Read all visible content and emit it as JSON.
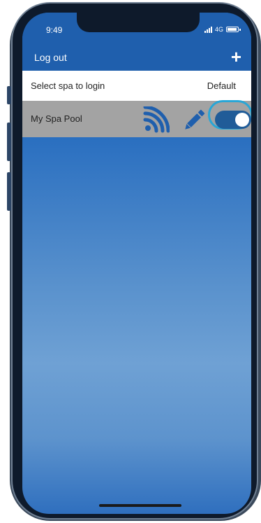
{
  "status_bar": {
    "time": "9:49",
    "network": "4G"
  },
  "header": {
    "logout_label": "Log out",
    "add_label": "+"
  },
  "select_row": {
    "label": "Select spa to login",
    "default_label": "Default"
  },
  "spa_list": [
    {
      "name": "My Spa Pool",
      "is_default": true
    }
  ],
  "icons": [
    "wifi-icon",
    "pencil-icon",
    "toggle-switch"
  ],
  "colors": {
    "header": "#1f5fad",
    "accent": "#205c98",
    "highlight_ring": "#29a6d6",
    "row_bg": "#a3a3a3"
  }
}
